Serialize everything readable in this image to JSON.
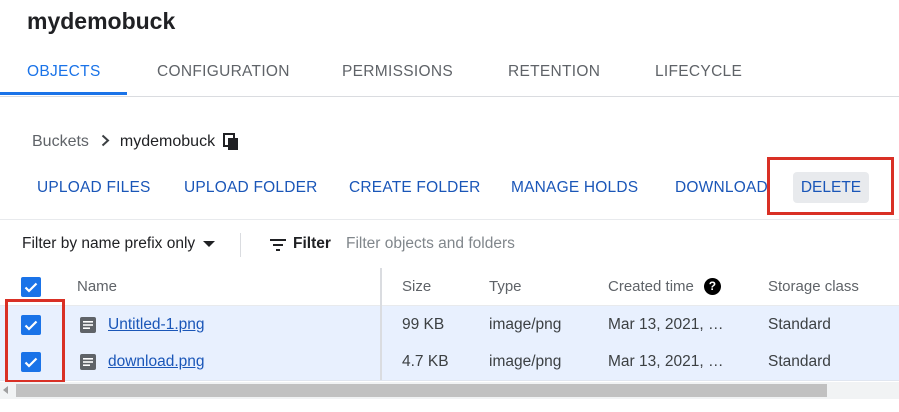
{
  "page": {
    "title": "mydemobuck"
  },
  "tabs": [
    {
      "label": "OBJECTS",
      "active": true
    },
    {
      "label": "CONFIGURATION",
      "active": false
    },
    {
      "label": "PERMISSIONS",
      "active": false
    },
    {
      "label": "RETENTION",
      "active": false
    },
    {
      "label": "LIFECYCLE",
      "active": false
    }
  ],
  "breadcrumb": {
    "root": "Buckets",
    "current": "mydemobuck",
    "copy_icon": "copy-icon"
  },
  "toolbar": {
    "upload_files": "UPLOAD FILES",
    "upload_folder": "UPLOAD FOLDER",
    "create_folder": "CREATE FOLDER",
    "manage_holds": "MANAGE HOLDS",
    "download": "DOWNLOAD",
    "delete": "DELETE"
  },
  "filter": {
    "prefix_select": "Filter by name prefix only",
    "label": "Filter",
    "placeholder": "Filter objects and folders"
  },
  "table": {
    "columns": {
      "name": "Name",
      "size": "Size",
      "type": "Type",
      "created": "Created time",
      "storage": "Storage class"
    },
    "rows": [
      {
        "name": "Untitled-1.png",
        "size": "99 KB",
        "type": "image/png",
        "created": "Mar 13, 2021, …",
        "storage": "Standard",
        "checked": true
      },
      {
        "name": "download.png",
        "size": "4.7 KB",
        "type": "image/png",
        "created": "Mar 13, 2021, …",
        "storage": "Standard",
        "checked": true
      }
    ]
  },
  "colors": {
    "accent": "#1a73e8",
    "link": "#1a56b8",
    "highlight_box": "#d93025",
    "selected_row": "#e8f0fe"
  }
}
